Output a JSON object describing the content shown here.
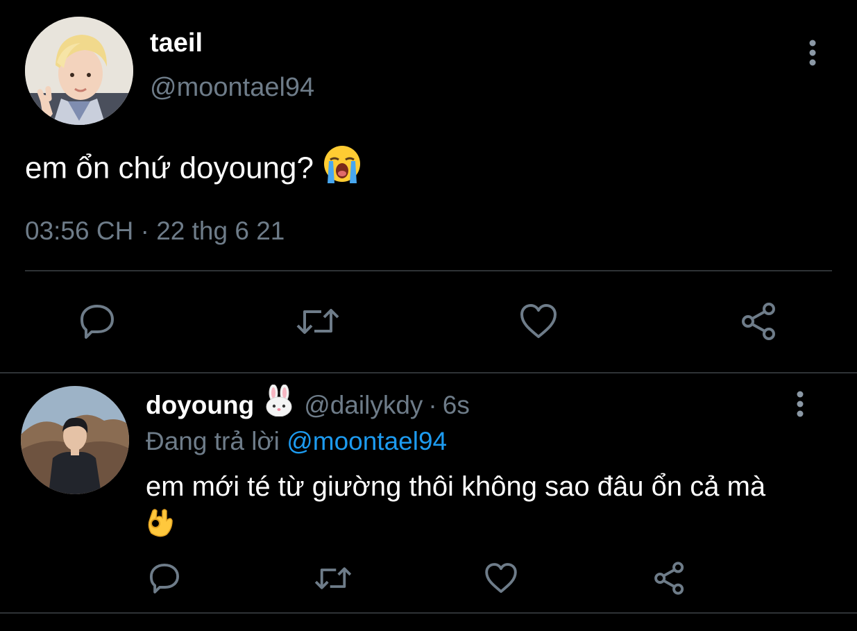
{
  "colors": {
    "background": "#000000",
    "primary_text": "#ffffff",
    "secondary_text": "#6e7c89",
    "link": "#1d9bf0",
    "divider": "#2f3336"
  },
  "main_tweet": {
    "display_name": "taeil",
    "handle": "@moontael94",
    "text": "em ổn chứ doyoung?",
    "emoji": "loudly-crying-face",
    "time": "03:56 CH",
    "separator": "·",
    "date": "22 thg 6 21",
    "actions": [
      "reply-icon",
      "retweet-icon",
      "like-icon",
      "share-icon"
    ]
  },
  "reply_tweet": {
    "display_name": "doyoung",
    "name_emoji": "rabbit-face",
    "handle": "@dailykdy",
    "separator": "·",
    "time_ago": "6s",
    "replying_label": "Đang trả lời",
    "replying_to": "@moontael94",
    "text": "em mới té từ giường thôi không sao đâu ổn cả mà",
    "emoji": "ok-hand",
    "actions": [
      "reply-icon",
      "retweet-icon",
      "like-icon",
      "share-icon"
    ]
  }
}
